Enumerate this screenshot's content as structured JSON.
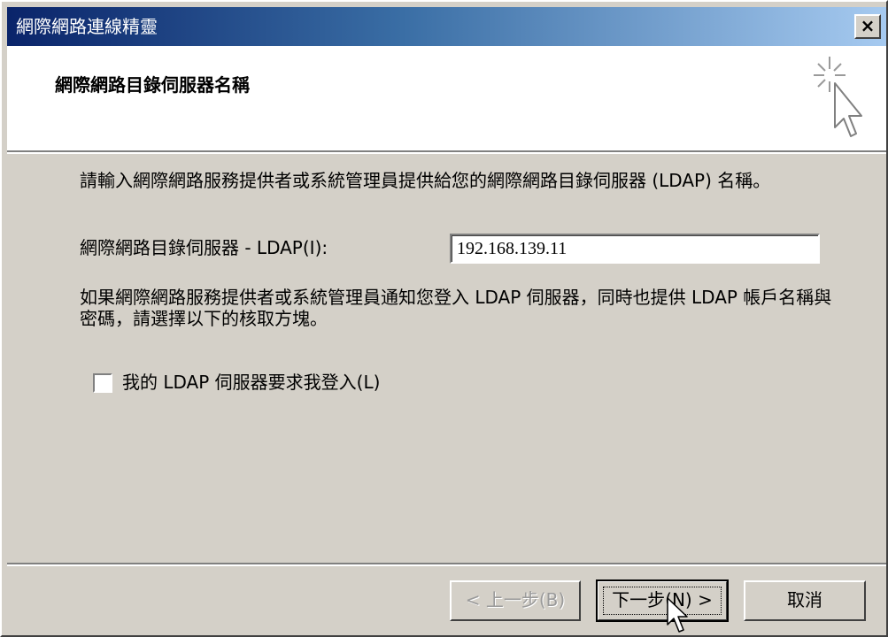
{
  "window": {
    "title": "網際網路連線精靈",
    "close_label": "×"
  },
  "header": {
    "title": "網際網路目錄伺服器名稱",
    "icon": "wizard-sparkle-cursor-icon"
  },
  "body": {
    "intro": "請輸入網際網路服務提供者或系統管理員提供給您的網際網路目錄伺服器 (LDAP) 名稱。",
    "ldap_label": "網際網路目錄伺服器 - LDAP(I):",
    "ldap_value": "192.168.139.11",
    "info": "如果網際網路服務提供者或系統管理員通知您登入 LDAP 伺服器，同時也提供 LDAP 帳戶名稱與密碼，請選擇以下的核取方塊。",
    "checkbox_label": "我的 LDAP 伺服器要求我登入(L)",
    "checkbox_checked": false
  },
  "footer": {
    "back_label": "< 上一步(B)",
    "next_label": "下一步(N) >",
    "cancel_label": "取消"
  },
  "colors": {
    "title_gradient_start": "#0a246a",
    "title_gradient_end": "#a6caf0",
    "dialog_face": "#d4d0c8"
  }
}
